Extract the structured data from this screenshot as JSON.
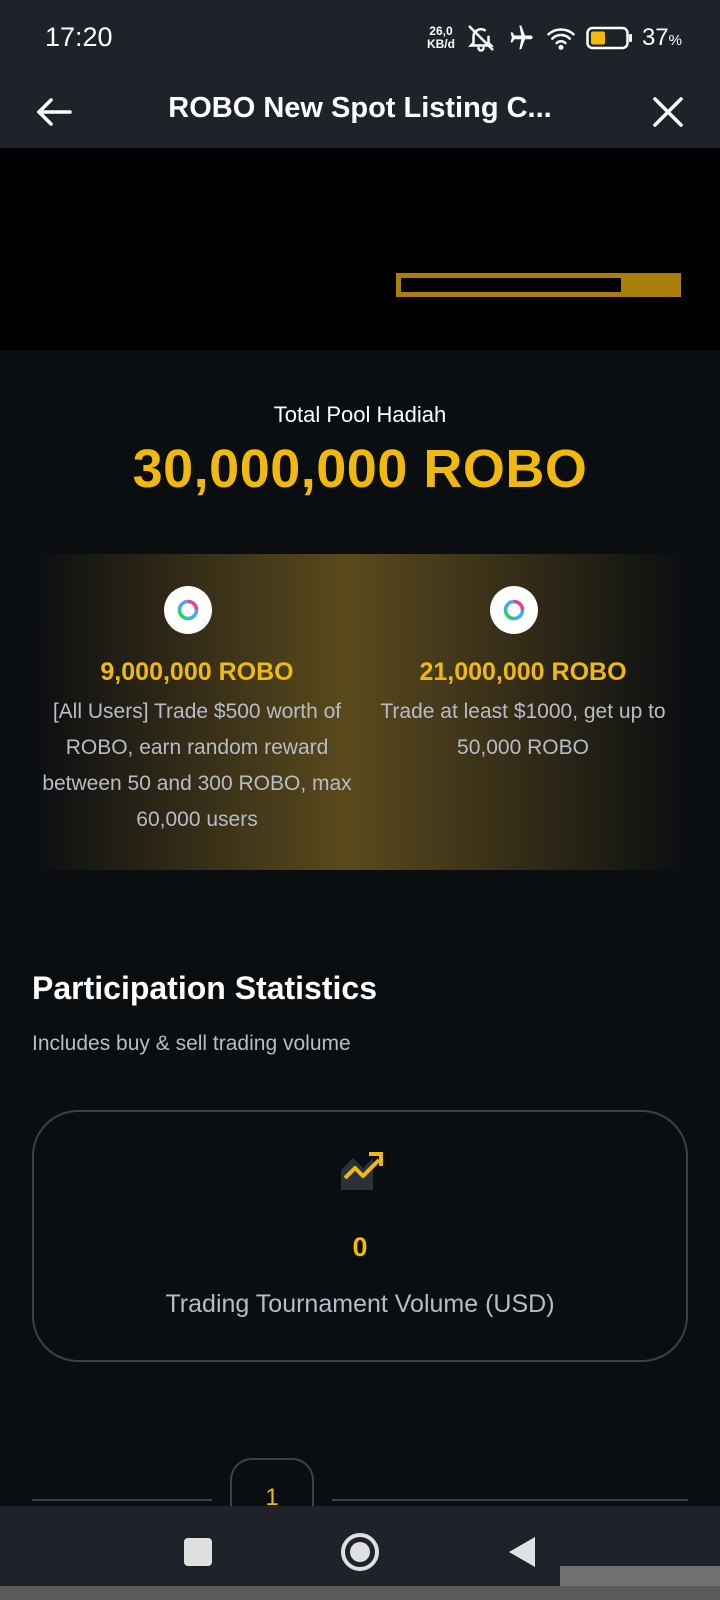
{
  "status_bar": {
    "time": "17:20",
    "net_speed_value": "26,0",
    "net_speed_unit": "KB/d",
    "battery_percent": "37",
    "battery_unit": "%"
  },
  "header": {
    "title": "ROBO New Spot Listing C..."
  },
  "pool": {
    "label": "Total Pool Hadiah",
    "amount": "30,000,000 ROBO"
  },
  "rewards": [
    {
      "amount": "9,000,000 ROBO",
      "description": "[All Users] Trade $500 worth of ROBO, earn random reward between 50 and 300 ROBO, max 60,000 users"
    },
    {
      "amount": "21,000,000 ROBO",
      "description": "Trade at least $1000, get up to 50,000 ROBO"
    }
  ],
  "statistics": {
    "title": "Participation Statistics",
    "subtitle": "Includes buy & sell trading volume",
    "value": "0",
    "label": "Trading Tournament Volume (USD)"
  },
  "pager": {
    "current": "1"
  },
  "colors": {
    "accent": "#f0b90b",
    "background": "#0b0e11",
    "surface": "#1e2329"
  }
}
